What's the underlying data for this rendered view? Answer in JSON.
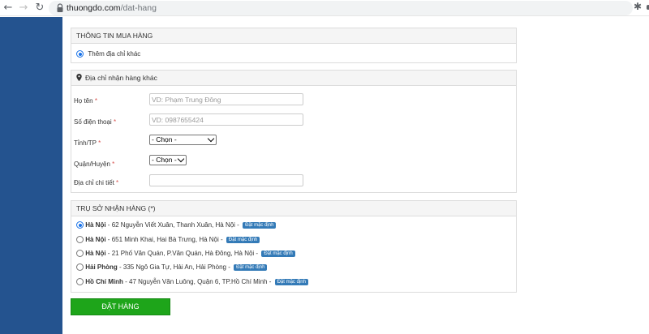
{
  "browser": {
    "url_host": "thuongdo.com",
    "url_path": "/dat-hang",
    "back_glyph": "←",
    "forward_glyph": "→",
    "reload_glyph": "↻",
    "star_glyph": "☆",
    "extension_glyph": "✱"
  },
  "colors": {
    "sidebar": "#24538f",
    "accent_blue": "#337ab7",
    "order_button": "#1ea51a"
  },
  "purchase_info": {
    "title": "THÔNG TIN MUA HÀNG",
    "option_label": "Thêm địa chỉ khác",
    "option_selected": true
  },
  "alt_address": {
    "title": "Địa chỉ nhận hàng khác",
    "title_icon": "map-marker-icon",
    "fields": {
      "name": {
        "label": "Họ tên",
        "required": "*",
        "placeholder": "VD: Phạm Trung Đông"
      },
      "phone": {
        "label": "Số điện thoại",
        "required": "*",
        "placeholder": "VD: 0987655424"
      },
      "province": {
        "label": "Tỉnh/TP",
        "required": "*",
        "value": "- Chọn -"
      },
      "district": {
        "label": "Quận/Huyện",
        "required": "*",
        "value": "- Chọn -"
      },
      "detail": {
        "label": "Địa chỉ chi tiết",
        "required": "*",
        "value": ""
      }
    }
  },
  "offices": {
    "title": "TRỤ SỞ NHẬN HÀNG (*)",
    "badge_label": "Đặt mặc định",
    "items": [
      {
        "city": "Hà Nội",
        "address": " - 62 Nguyễn Viết Xuân, Thanh Xuân, Hà Nội - ",
        "selected": true
      },
      {
        "city": "Hà Nội",
        "address": " - 651 Minh Khai, Hai Bà Trưng, Hà Nội - ",
        "selected": false
      },
      {
        "city": "Hà Nội",
        "address": " - 21 Phố Văn Quán, P.Văn Quán, Hà Đông, Hà Nội - ",
        "selected": false
      },
      {
        "city": "Hải Phòng",
        "address": " - 335 Ngô Gia Tự, Hải An, Hải Phòng - ",
        "selected": false
      },
      {
        "city": "Hồ Chí Minh",
        "address": " - 47 Nguyễn Văn Luông, Quận 6, TP.Hồ Chí Minh - ",
        "selected": false
      }
    ]
  },
  "order_button_label": "ĐẶT HÀNG"
}
